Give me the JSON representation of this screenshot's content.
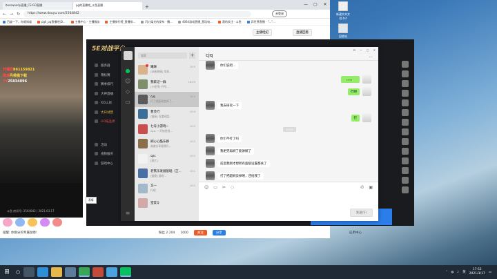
{
  "desktop": {
    "icons": [
      {
        "label": "新建文本文档.txt"
      },
      {
        "label": "回收站"
      }
    ]
  },
  "browser": {
    "tabs": [
      {
        "label": "bosswoody直播_CS:GO直播"
      },
      {
        "label": "pg的直播吧_斗鱼直播"
      }
    ],
    "new_tab": "+",
    "win_controls": {
      "min": "—",
      "max": "▢",
      "close": "✕"
    },
    "url": "https://www.douyu.com/2564842",
    "account_label": "未登录",
    "bookmarks": [
      "百度一下，你就知道",
      "pgll_pg直播吧|D...",
      "主播中心 · 主播服务",
      "主播排行榜_直播排...",
      "闪刀架光的发布 · 播...",
      "4064游戏直播_直玩电...",
      "我的关注 · 斗鱼",
      "异世界直播 · \"...\"..."
    ]
  },
  "webpage": {
    "overlay": {
      "line1_prefix": "开播群",
      "line1_value": "861159821",
      "line2_prefix": "微博",
      "line2_value": "丹佛猫下载",
      "line3_prefix": "YY",
      "line3_value": "25834096"
    },
    "room_meta": "斗鱼 房间号: 2564842 | 2021.03.17",
    "notice": "提醒: 你刚分的专属勋章!",
    "live_panel": {
      "btn1": "主播经纪",
      "btn2": "直播回看"
    },
    "room_logo": "5E对战平台",
    "room_menu": [
      "服务器",
      "锦标赛",
      "赛季排行",
      "大神直播",
      "ROLL房",
      "大日试营",
      "GO拓品牌"
    ],
    "room_menu_footer": [
      "活动",
      "视频服务",
      "游戏中心"
    ],
    "bottom_bar": {
      "fans": "粉丝 2.204",
      "level": "1000",
      "follow": "关注",
      "share": "分享"
    },
    "bottom_right": "应用中心"
  },
  "wechat": {
    "search_placeholder": "搜索",
    "plus": "+",
    "chat_title": "cjq",
    "conversations": [
      {
        "name": "曦琳",
        "msg": "[动画表情] 发表...",
        "time": "10:5",
        "unread": true
      },
      {
        "name": "我家记一群",
        "msg": "[小程序] 开号...",
        "time": "16:49",
        "unread": false
      },
      {
        "name": "cjq",
        "msg": "打了把面刷卖掉了...",
        "time": "10:5",
        "unread": false
      },
      {
        "name": "曹佳行",
        "msg": "[链接] 百度网盘...",
        "time": "10:4",
        "unread": false
      },
      {
        "name": "七号小游戏~",
        "msg": "Aya: 一开始他说...",
        "time": "10:2",
        "unread": false
      },
      {
        "name": "刷心心酷乐群",
        "msg": "谢谢分享视频号...",
        "time": "10:2",
        "unread": false
      },
      {
        "name": "qzc",
        "msg": "[图片]",
        "time": "10:2",
        "unread": false
      },
      {
        "name": "老铁乐发展基础（正...",
        "msg": "[链接] 游戏...",
        "time": "10:1",
        "unread": false
      },
      {
        "name": "又一",
        "msg": "行吧",
        "time": "10:1",
        "unread": false
      },
      {
        "name": "室友Q",
        "msg": "",
        "time": "",
        "unread": false
      }
    ],
    "messages": [
      {
        "from": "them",
        "text": "你们说吧..."
      },
      {
        "from": "me",
        "text": "。。。。"
      },
      {
        "from": "me",
        "text": "行吧"
      },
      {
        "from": "them",
        "text": "我去研究一下"
      },
      {
        "from": "me",
        "text": "行"
      },
      {
        "from": "them",
        "text": "你们不打了吗"
      },
      {
        "from": "them",
        "text": "我更完再刷了能讲解了"
      },
      {
        "from": "them",
        "text": "前后我刚才想所有超级设置都关了"
      },
      {
        "from": "them",
        "text": "打了把超刷卖掉咯，还给我了"
      }
    ],
    "time_separator": "10:50",
    "tooltip": "表情",
    "send_label": "发送(S)",
    "window_controls": {
      "pin": "⊟",
      "min": "—",
      "max": "▢",
      "close": "✕"
    }
  },
  "taskbar": {
    "time": "17:52",
    "date": "2021/3/17",
    "lang": "英"
  }
}
